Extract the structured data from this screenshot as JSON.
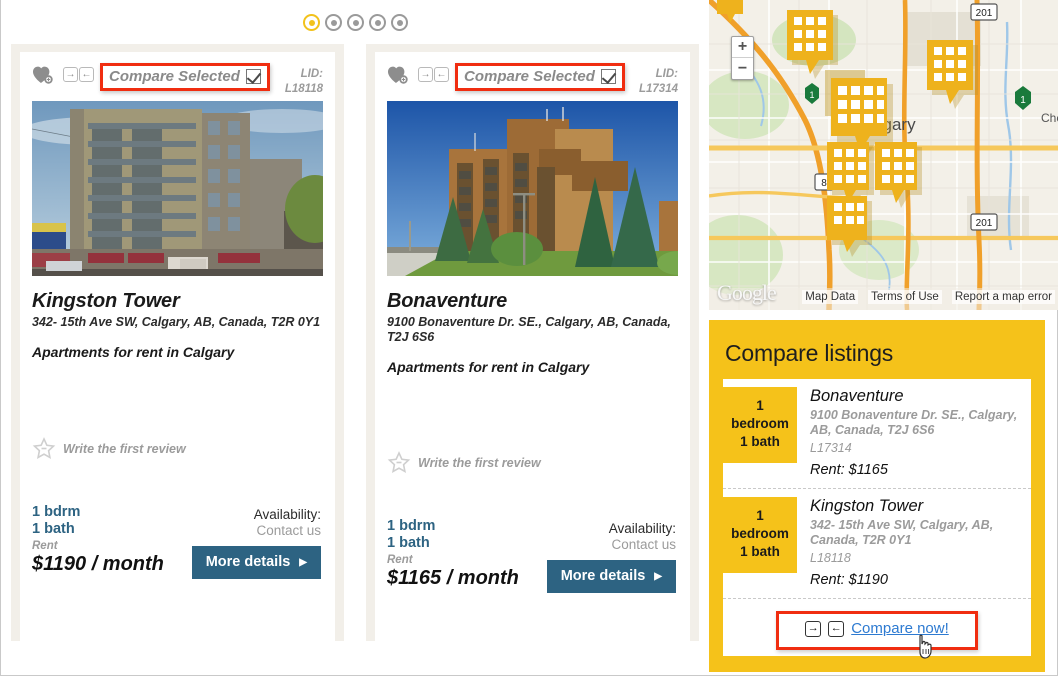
{
  "pager": {
    "count": 5,
    "active_index": 0
  },
  "listings": [
    {
      "compare_label": "Compare Selected",
      "lid_label": "LID:",
      "lid_value": "L18118",
      "title": "Kingston Tower",
      "address": "342- 15th Ave SW, Calgary, AB, Canada, T2R 0Y1",
      "subtitle": "Apartments for rent in Calgary",
      "review_text": "Write the first review",
      "bedrooms": "1 bdrm",
      "baths": "1 bath",
      "rent_label": "Rent",
      "price": "$1190 / month",
      "availability_label": "Availability:",
      "availability_value": "Contact us",
      "details_button": "More details",
      "photo_alt": "beige-apartment-tower-with-balconies"
    },
    {
      "compare_label": "Compare Selected",
      "lid_label": "LID:",
      "lid_value": "L17314",
      "title": "Bonaventure",
      "address": "9100 Bonaventure Dr. SE., Calgary, AB, Canada, T2J 6S6",
      "subtitle": "Apartments for rent in Calgary",
      "review_text": "Write the first review",
      "bedrooms": "1 bdrm",
      "baths": "1 bath",
      "rent_label": "Rent",
      "price": "$1165 / month",
      "availability_label": "Availability:",
      "availability_value": "Contact us",
      "details_button": "More details",
      "photo_alt": "brown-brick-highrise-with-evergreen-trees"
    }
  ],
  "map": {
    "city_label": "Calgary",
    "place_label": "Che",
    "shield_201_a": "201",
    "shield_201_b": "201",
    "shield_8": "8",
    "shield_1_a": "1",
    "shield_1_b": "1",
    "zoom_in": "+",
    "zoom_out": "−",
    "brand": "Google",
    "footer_links": [
      "Map Data",
      "Terms of Use",
      "Report a map error"
    ],
    "marker_count": 7
  },
  "compare_panel": {
    "title": "Compare listings",
    "rows": [
      {
        "badge_count": "1",
        "badge_bedroom": "bedroom",
        "badge_bath": "1 bath",
        "name": "Bonaventure",
        "address": "9100 Bonaventure Dr. SE., Calgary, AB, Canada, T2J 6S6",
        "lid": "L17314",
        "rent": "Rent: $1165"
      },
      {
        "badge_count": "1",
        "badge_bedroom": "bedroom",
        "badge_bath": "1 bath",
        "name": "Kingston Tower",
        "address": "342- 15th Ave SW, Calgary, AB, Canada, T2R 0Y1",
        "lid": "L18118",
        "rent": "Rent: $1190"
      }
    ],
    "compare_now": "Compare now!"
  },
  "colors": {
    "accent_yellow": "#f5c21a",
    "button_blue": "#2d6382",
    "highlight_red": "#f02d10",
    "link_blue": "#2d7ad1",
    "card_frame": "#f2efe9"
  }
}
